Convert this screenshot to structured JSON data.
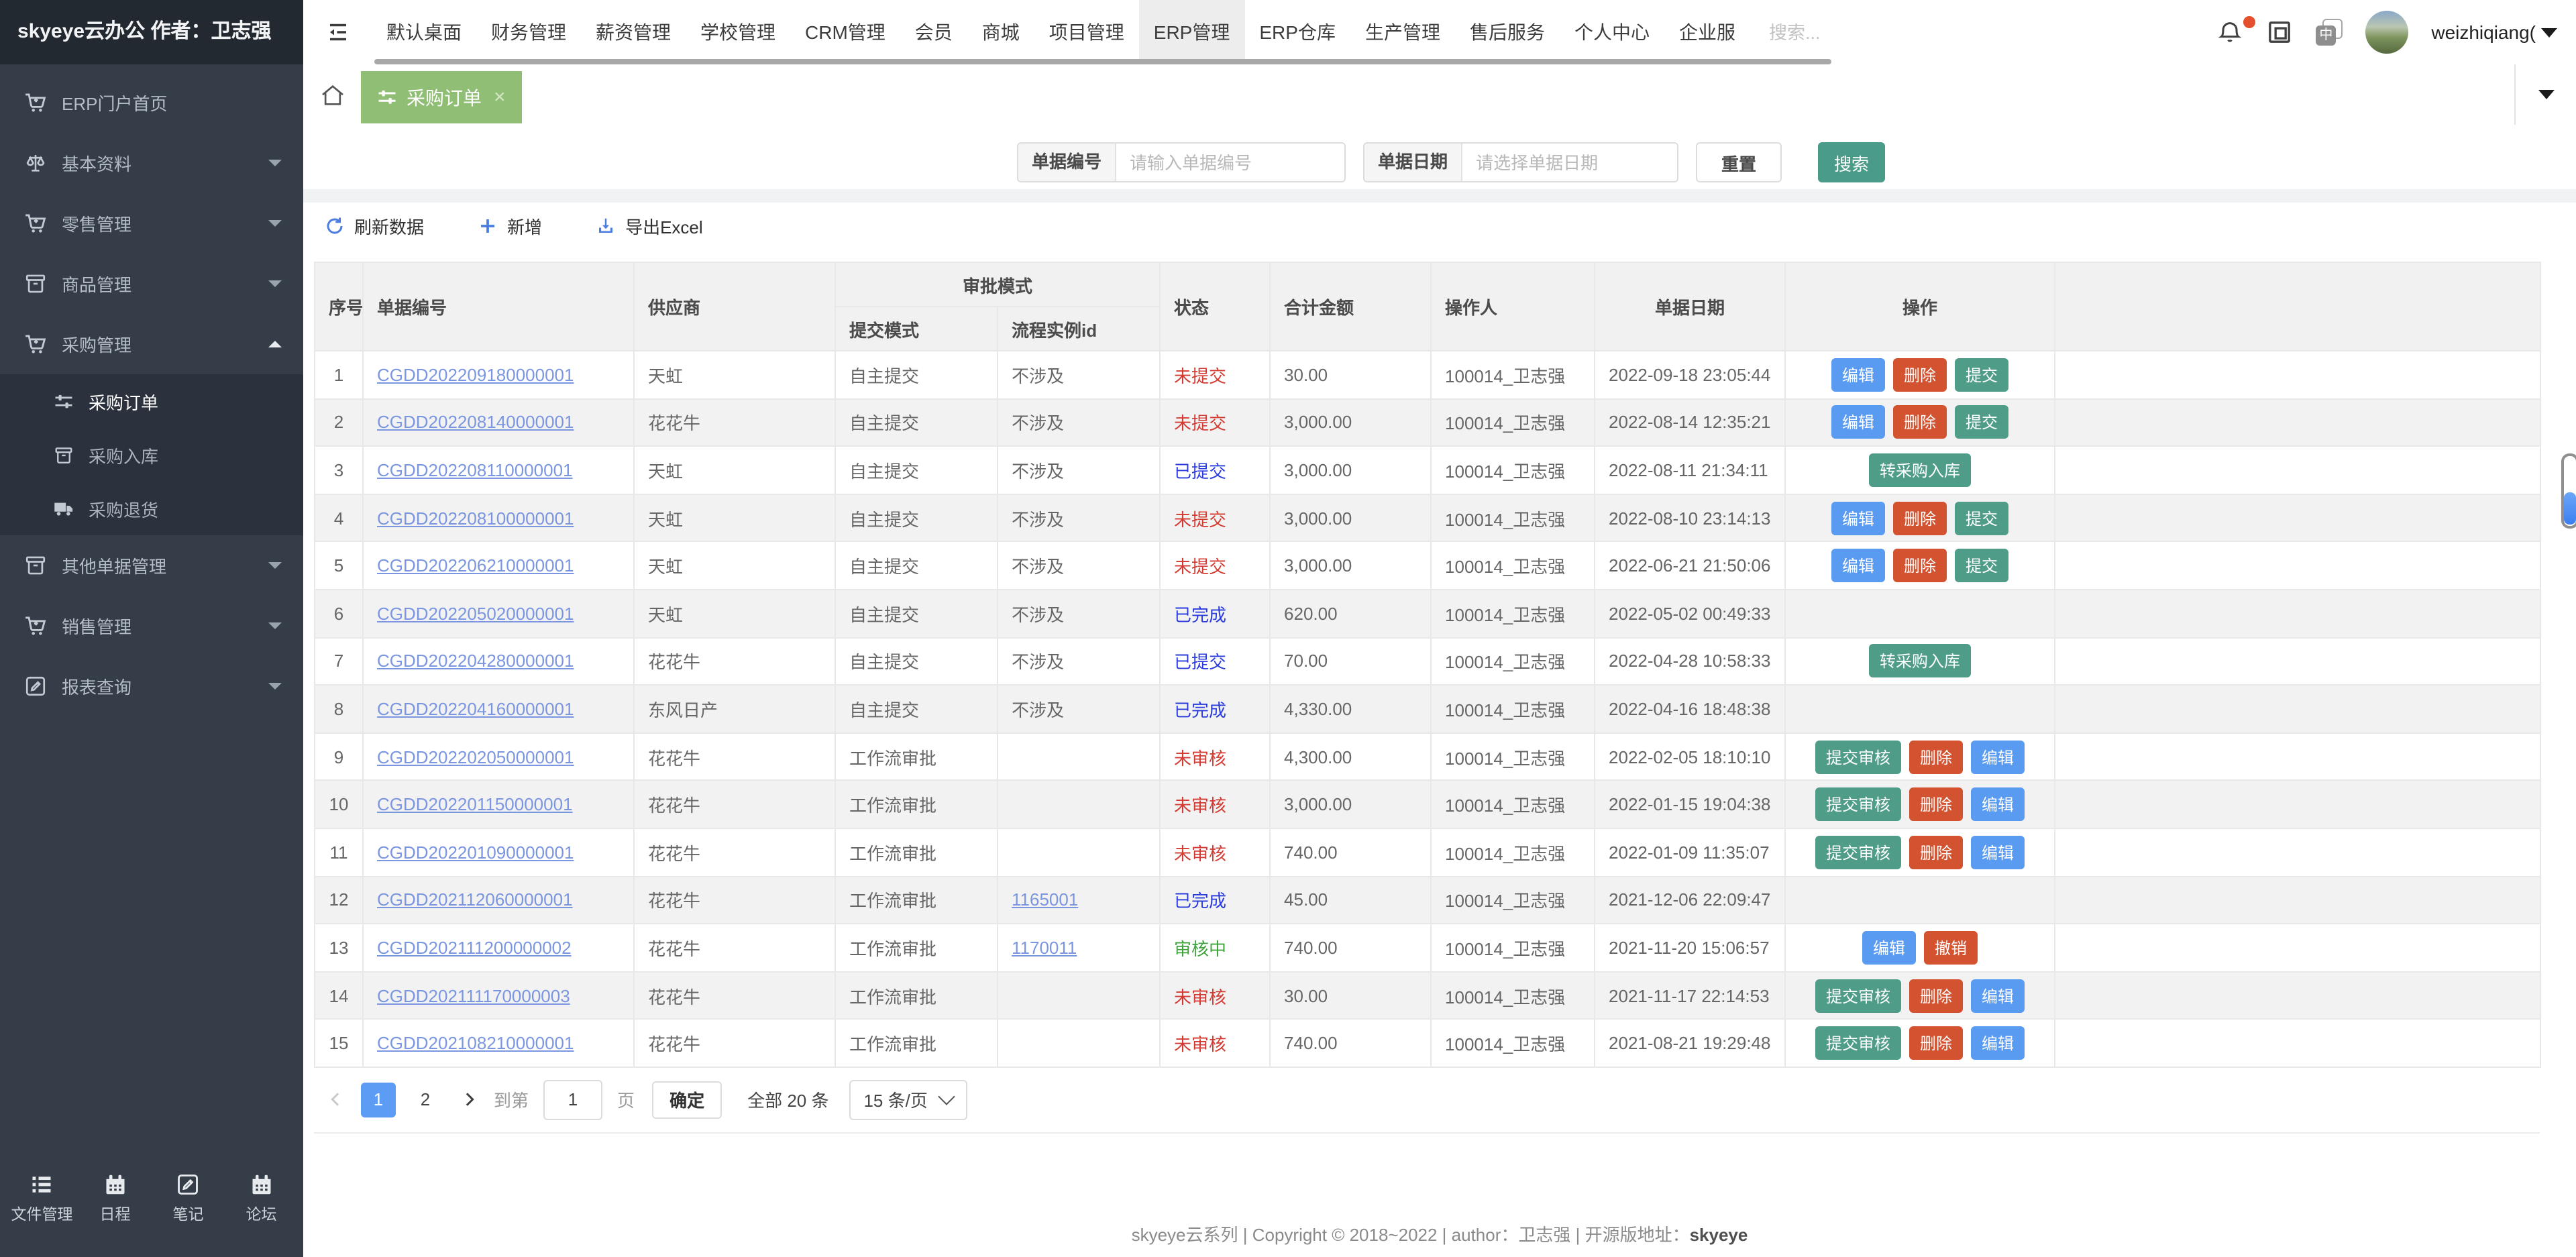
{
  "brand": {
    "logo": "skyeye云办公 作者：卫志强"
  },
  "topnav": {
    "items": [
      {
        "label": "默认桌面",
        "active": false
      },
      {
        "label": "财务管理",
        "active": false
      },
      {
        "label": "薪资管理",
        "active": false
      },
      {
        "label": "学校管理",
        "active": false
      },
      {
        "label": "CRM管理",
        "active": false
      },
      {
        "label": "会员",
        "active": false
      },
      {
        "label": "商城",
        "active": false
      },
      {
        "label": "项目管理",
        "active": false
      },
      {
        "label": "ERP管理",
        "active": true
      },
      {
        "label": "ERP仓库",
        "active": false
      },
      {
        "label": "生产管理",
        "active": false
      },
      {
        "label": "售后服务",
        "active": false
      },
      {
        "label": "个人中心",
        "active": false
      },
      {
        "label": "企业服",
        "active": false
      }
    ],
    "search_placeholder": "搜索...",
    "username": "weizhiqiang("
  },
  "sidebar": {
    "items": [
      {
        "icon": "cart",
        "label": "ERP门户首页",
        "chevron": ""
      },
      {
        "icon": "scales",
        "label": "基本资料",
        "chevron": "down"
      },
      {
        "icon": "cart",
        "label": "零售管理",
        "chevron": "down"
      },
      {
        "icon": "box",
        "label": "商品管理",
        "chevron": "down"
      },
      {
        "icon": "cart",
        "label": "采购管理",
        "chevron": "up",
        "children": [
          {
            "icon": "sliders",
            "label": "采购订单",
            "active": true
          },
          {
            "icon": "box",
            "label": "采购入库",
            "active": false
          },
          {
            "icon": "truck",
            "label": "采购退货",
            "active": false
          }
        ]
      },
      {
        "icon": "box",
        "label": "其他单据管理",
        "chevron": "down"
      },
      {
        "icon": "cart",
        "label": "销售管理",
        "chevron": "down"
      },
      {
        "icon": "pen",
        "label": "报表查询",
        "chevron": "down"
      }
    ],
    "footer_items": [
      {
        "icon": "list",
        "label": "文件管理"
      },
      {
        "icon": "calendar",
        "label": "日程"
      },
      {
        "icon": "pen",
        "label": "笔记"
      },
      {
        "icon": "calendar",
        "label": "论坛"
      }
    ]
  },
  "tabbar": {
    "active_tab": "采购订单",
    "close_glyph": "×"
  },
  "filters": {
    "fields": [
      {
        "label": "单据编号",
        "placeholder": "请输入单据编号"
      },
      {
        "label": "单据日期",
        "placeholder": "请选择单据日期"
      }
    ],
    "reset_label": "重置",
    "search_label": "搜索"
  },
  "toolbar": {
    "items": [
      {
        "icon": "refresh",
        "label": "刷新数据"
      },
      {
        "icon": "plus",
        "label": "新增"
      },
      {
        "icon": "download",
        "label": "导出Excel"
      }
    ]
  },
  "table": {
    "headers": {
      "seq": "序号",
      "order_no": "单据编号",
      "supplier": "供应商",
      "approval_group": "审批模式",
      "submit_mode": "提交模式",
      "flow_id": "流程实例id",
      "status": "状态",
      "amount": "合计金额",
      "operator": "操作人",
      "date": "单据日期",
      "actions": "操作"
    },
    "rows": [
      {
        "seq": "1",
        "order_no": "CGDD202209180000001",
        "supplier": "天虹",
        "submit_mode": "自主提交",
        "flow_id": "不涉及",
        "flow_link": false,
        "status": "未提交",
        "status_color": "red",
        "amount": "30.00",
        "operator": "100014_卫志强",
        "date": "2022-09-18 23:05:44",
        "actions": [
          {
            "label": "编辑",
            "color": "blue"
          },
          {
            "label": "删除",
            "color": "red"
          },
          {
            "label": "提交",
            "color": "teal"
          }
        ]
      },
      {
        "seq": "2",
        "order_no": "CGDD202208140000001",
        "supplier": "花花牛",
        "submit_mode": "自主提交",
        "flow_id": "不涉及",
        "flow_link": false,
        "status": "未提交",
        "status_color": "red",
        "amount": "3,000.00",
        "operator": "100014_卫志强",
        "date": "2022-08-14 12:35:21",
        "actions": [
          {
            "label": "编辑",
            "color": "blue"
          },
          {
            "label": "删除",
            "color": "red"
          },
          {
            "label": "提交",
            "color": "teal"
          }
        ]
      },
      {
        "seq": "3",
        "order_no": "CGDD202208110000001",
        "supplier": "天虹",
        "submit_mode": "自主提交",
        "flow_id": "不涉及",
        "flow_link": false,
        "status": "已提交",
        "status_color": "blue",
        "amount": "3,000.00",
        "operator": "100014_卫志强",
        "date": "2022-08-11 21:34:11",
        "actions": [
          {
            "label": "转采购入库",
            "color": "teal"
          }
        ]
      },
      {
        "seq": "4",
        "order_no": "CGDD202208100000001",
        "supplier": "天虹",
        "submit_mode": "自主提交",
        "flow_id": "不涉及",
        "flow_link": false,
        "status": "未提交",
        "status_color": "red",
        "amount": "3,000.00",
        "operator": "100014_卫志强",
        "date": "2022-08-10 23:14:13",
        "actions": [
          {
            "label": "编辑",
            "color": "blue"
          },
          {
            "label": "删除",
            "color": "red"
          },
          {
            "label": "提交",
            "color": "teal"
          }
        ]
      },
      {
        "seq": "5",
        "order_no": "CGDD202206210000001",
        "supplier": "天虹",
        "submit_mode": "自主提交",
        "flow_id": "不涉及",
        "flow_link": false,
        "status": "未提交",
        "status_color": "red",
        "amount": "3,000.00",
        "operator": "100014_卫志强",
        "date": "2022-06-21 21:50:06",
        "actions": [
          {
            "label": "编辑",
            "color": "blue"
          },
          {
            "label": "删除",
            "color": "red"
          },
          {
            "label": "提交",
            "color": "teal"
          }
        ]
      },
      {
        "seq": "6",
        "order_no": "CGDD202205020000001",
        "supplier": "天虹",
        "submit_mode": "自主提交",
        "flow_id": "不涉及",
        "flow_link": false,
        "status": "已完成",
        "status_color": "blue",
        "amount": "620.00",
        "operator": "100014_卫志强",
        "date": "2022-05-02 00:49:33",
        "actions": []
      },
      {
        "seq": "7",
        "order_no": "CGDD202204280000001",
        "supplier": "花花牛",
        "submit_mode": "自主提交",
        "flow_id": "不涉及",
        "flow_link": false,
        "status": "已提交",
        "status_color": "blue",
        "amount": "70.00",
        "operator": "100014_卫志强",
        "date": "2022-04-28 10:58:33",
        "actions": [
          {
            "label": "转采购入库",
            "color": "teal"
          }
        ]
      },
      {
        "seq": "8",
        "order_no": "CGDD202204160000001",
        "supplier": "东风日产",
        "submit_mode": "自主提交",
        "flow_id": "不涉及",
        "flow_link": false,
        "status": "已完成",
        "status_color": "blue",
        "amount": "4,330.00",
        "operator": "100014_卫志强",
        "date": "2022-04-16 18:48:38",
        "actions": []
      },
      {
        "seq": "9",
        "order_no": "CGDD202202050000001",
        "supplier": "花花牛",
        "submit_mode": "工作流审批",
        "flow_id": "",
        "flow_link": false,
        "status": "未审核",
        "status_color": "red",
        "amount": "4,300.00",
        "operator": "100014_卫志强",
        "date": "2022-02-05 18:10:10",
        "actions": [
          {
            "label": "提交审核",
            "color": "teal"
          },
          {
            "label": "删除",
            "color": "red"
          },
          {
            "label": "编辑",
            "color": "blue"
          }
        ]
      },
      {
        "seq": "10",
        "order_no": "CGDD202201150000001",
        "supplier": "花花牛",
        "submit_mode": "工作流审批",
        "flow_id": "",
        "flow_link": false,
        "status": "未审核",
        "status_color": "red",
        "amount": "3,000.00",
        "operator": "100014_卫志强",
        "date": "2022-01-15 19:04:38",
        "actions": [
          {
            "label": "提交审核",
            "color": "teal"
          },
          {
            "label": "删除",
            "color": "red"
          },
          {
            "label": "编辑",
            "color": "blue"
          }
        ]
      },
      {
        "seq": "11",
        "order_no": "CGDD202201090000001",
        "supplier": "花花牛",
        "submit_mode": "工作流审批",
        "flow_id": "",
        "flow_link": false,
        "status": "未审核",
        "status_color": "red",
        "amount": "740.00",
        "operator": "100014_卫志强",
        "date": "2022-01-09 11:35:07",
        "actions": [
          {
            "label": "提交审核",
            "color": "teal"
          },
          {
            "label": "删除",
            "color": "red"
          },
          {
            "label": "编辑",
            "color": "blue"
          }
        ]
      },
      {
        "seq": "12",
        "order_no": "CGDD202112060000001",
        "supplier": "花花牛",
        "submit_mode": "工作流审批",
        "flow_id": "1165001",
        "flow_link": true,
        "status": "已完成",
        "status_color": "blue",
        "amount": "45.00",
        "operator": "100014_卫志强",
        "date": "2021-12-06 22:09:47",
        "actions": []
      },
      {
        "seq": "13",
        "order_no": "CGDD202111200000002",
        "supplier": "花花牛",
        "submit_mode": "工作流审批",
        "flow_id": "1170011",
        "flow_link": true,
        "status": "审核中",
        "status_color": "green",
        "amount": "740.00",
        "operator": "100014_卫志强",
        "date": "2021-11-20 15:06:57",
        "actions": [
          {
            "label": "编辑",
            "color": "blue"
          },
          {
            "label": "撤销",
            "color": "red"
          }
        ]
      },
      {
        "seq": "14",
        "order_no": "CGDD202111170000003",
        "supplier": "花花牛",
        "submit_mode": "工作流审批",
        "flow_id": "",
        "flow_link": false,
        "status": "未审核",
        "status_color": "red",
        "amount": "30.00",
        "operator": "100014_卫志强",
        "date": "2021-11-17 22:14:53",
        "actions": [
          {
            "label": "提交审核",
            "color": "teal"
          },
          {
            "label": "删除",
            "color": "red"
          },
          {
            "label": "编辑",
            "color": "blue"
          }
        ]
      },
      {
        "seq": "15",
        "order_no": "CGDD202108210000001",
        "supplier": "花花牛",
        "submit_mode": "工作流审批",
        "flow_id": "",
        "flow_link": false,
        "status": "未审核",
        "status_color": "red",
        "amount": "740.00",
        "operator": "100014_卫志强",
        "date": "2021-08-21 19:29:48",
        "actions": [
          {
            "label": "提交审核",
            "color": "teal"
          },
          {
            "label": "删除",
            "color": "red"
          },
          {
            "label": "编辑",
            "color": "blue"
          }
        ]
      }
    ]
  },
  "pagination": {
    "pages": [
      "1",
      "2"
    ],
    "active_page": "1",
    "goto_label": "到第",
    "goto_value": "1",
    "page_unit": "页",
    "confirm_label": "确定",
    "total_label": "全部 20 条",
    "page_size_label": "15 条/页"
  },
  "footer": {
    "text": "skyeye云系列 | Copyright © 2018~2022 | author：卫志强 | 开源版地址：",
    "link": "skyeye"
  },
  "colors": {
    "accent_teal": "#4f9d89",
    "accent_blue": "#5a9bf2",
    "accent_red": "#d35230",
    "tab_green": "#8fbe74",
    "status_red": "#d43a31",
    "status_blue": "#2a3bdd",
    "status_green": "#3fa43c",
    "sidebar_bg": "#353d49"
  }
}
